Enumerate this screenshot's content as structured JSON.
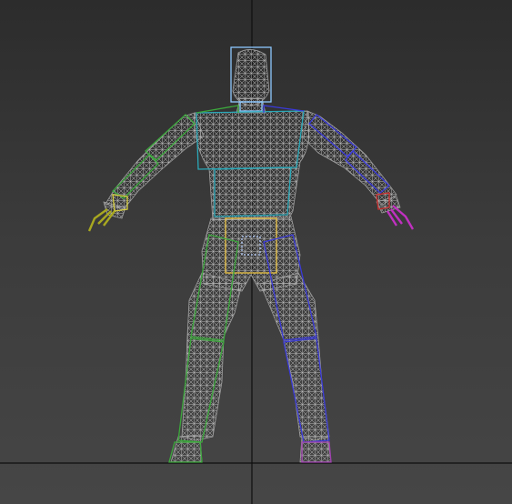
{
  "viewport": {
    "view": "front",
    "shading": "wireframe",
    "colors": {
      "background_top": "#2c2c2c",
      "background_bottom": "#464646",
      "axis_line": "#0f0f0f",
      "mesh": "#9a9a9a",
      "bone_head": "#8ec8ff",
      "bone_spine": "#2aa8b8",
      "bone_pelvis": "#e8c040",
      "bone_left_side": "#3ca83c",
      "bone_right_side": "#3a3ad8",
      "hand_left": "#d8d040",
      "hand_right": "#cc3030",
      "fingers_left": "#a8a820",
      "fingers_right": "#c030c0",
      "foot_right": "#a040b0"
    },
    "icons": [
      "character-mesh-wireframe",
      "biped-skeleton-overlay",
      "world-axis-lines"
    ]
  }
}
